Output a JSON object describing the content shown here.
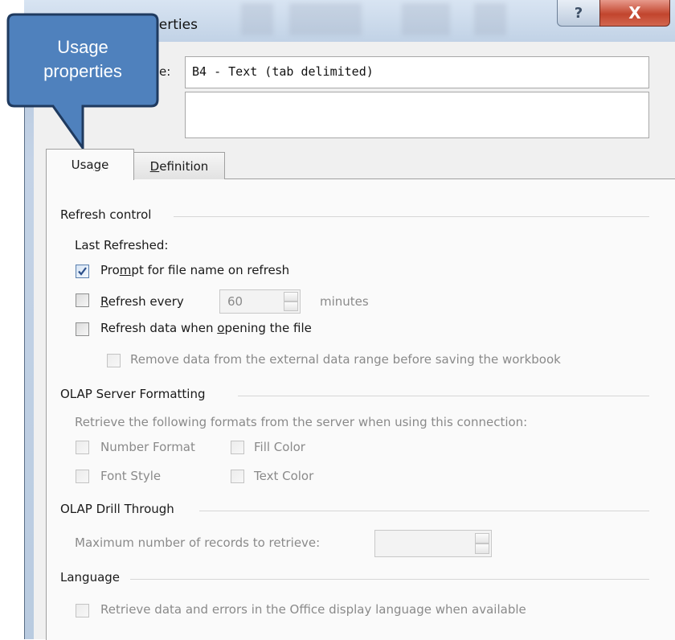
{
  "window": {
    "title": "Connection Properties",
    "title_visible": "perties",
    "help_label": "?",
    "close_label": "X"
  },
  "fields": {
    "name_label": "Connection name:",
    "name_label_visible": "e:",
    "name_value": "B4 - Text (tab delimited)",
    "description_value": ""
  },
  "tabs": [
    {
      "label": "Usage",
      "underline_char": "g",
      "selected": true
    },
    {
      "label": "Definition",
      "underline_char": "D",
      "selected": false
    }
  ],
  "refresh_control": {
    "header": "Refresh control",
    "last_refreshed": "Last Refreshed:",
    "prompt_label": "Prompt for file name on refresh",
    "prompt_checked": true,
    "refresh_every_label": "Refresh every",
    "refresh_every_value": "60",
    "minutes_label": "minutes",
    "refresh_open_label": "Refresh data when opening the file",
    "remove_data_label": "Remove data from the external data range before saving the workbook"
  },
  "olap_formatting": {
    "header": "OLAP Server Formatting",
    "description": "Retrieve the following formats from the server when using this connection:",
    "number_format": "Number Format",
    "fill_color": "Fill Color",
    "font_style": "Font Style",
    "text_color": "Text Color"
  },
  "olap_drill": {
    "header": "OLAP Drill Through",
    "max_records_label": "Maximum number of records to retrieve:",
    "max_records_value": ""
  },
  "language": {
    "header": "Language",
    "retrieve_label": "Retrieve data and errors in the Office display language when available"
  },
  "callout": {
    "line1": "Usage",
    "line2": "properties",
    "color": "#4f81bd",
    "border_color": "#1f3a5f"
  }
}
